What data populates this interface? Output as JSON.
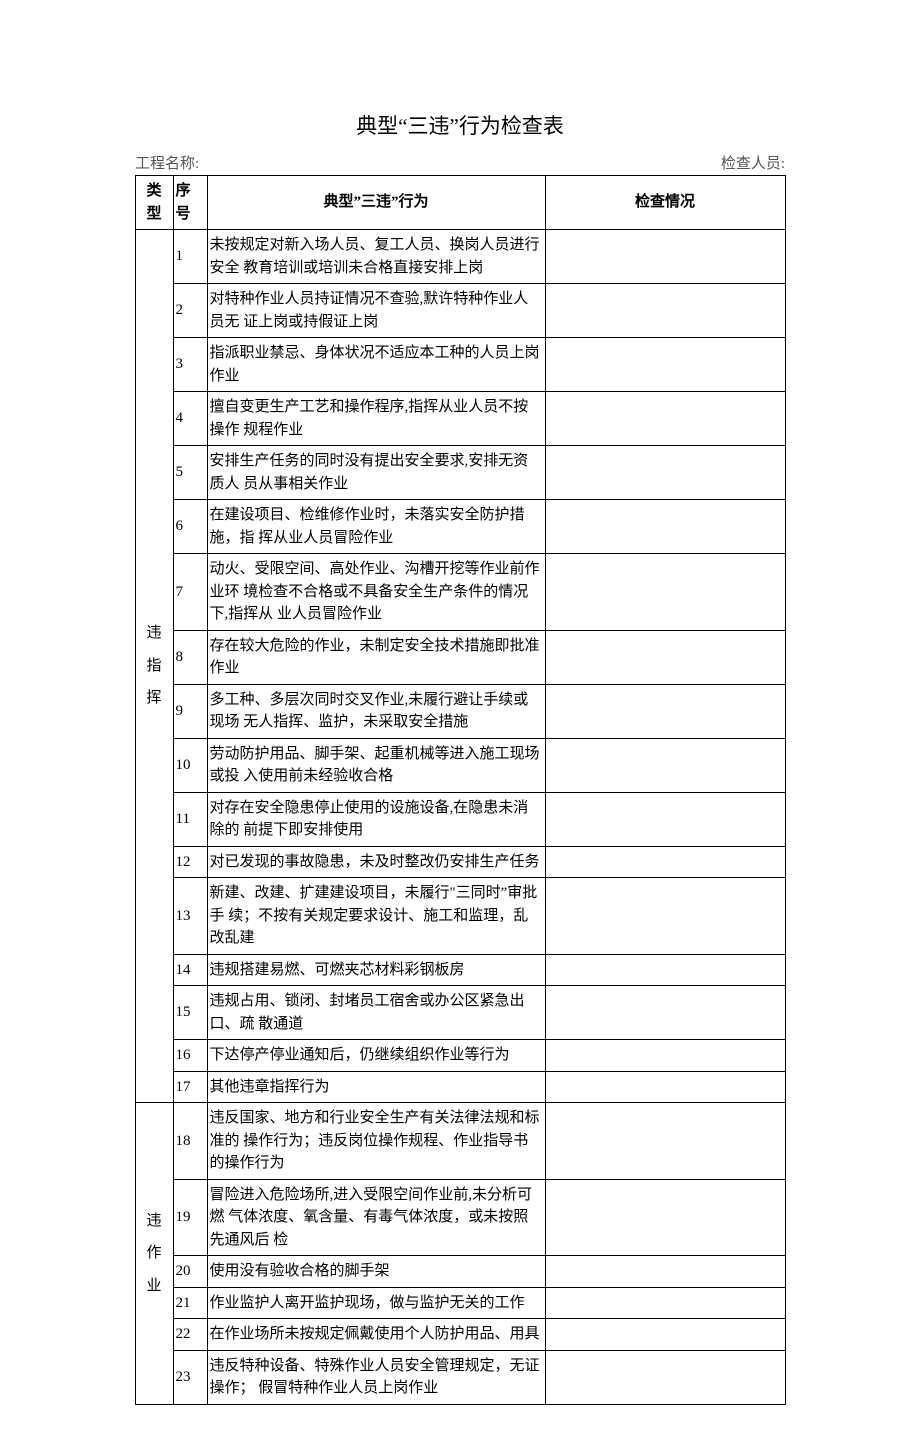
{
  "title": "典型“三违”行为检查表",
  "meta": {
    "project_label": "工程名称:",
    "inspector_label": "检查人员:"
  },
  "headers": {
    "category": "类 型",
    "index": "序 号",
    "behavior": "典型”三违”行为",
    "status": "检查情况"
  },
  "sections": [
    {
      "category_chars": [
        "违",
        "指",
        "挥"
      ],
      "rows": [
        {
          "n": "1",
          "text": "未按规定对新入场人员、复工人员、换岗人员进行安全  教育培训或培训未合格直接安排上岗"
        },
        {
          "n": "2",
          "text": "对特种作业人员持证情况不查验,默许特种作业人员无  证上岗或持假证上岗"
        },
        {
          "n": "3",
          "text": "指派职业禁忌、身体状况不适应本工种的人员上岗作业"
        },
        {
          "n": "4",
          "text": "擅自变更生产工艺和操作程序,指挥从业人员不按操作  规程作业"
        },
        {
          "n": "5",
          "text": "安排生产任务的同时没有提出安全要求,安排无资质人  员从事相关作业"
        },
        {
          "n": "6",
          "text": "在建设项目、检维修作业时，未落实安全防护措施，指  挥从业人员冒险作业"
        },
        {
          "n": "7",
          "text": "动火、受限空间、高处作业、沟槽开挖等作业前作业环  境检查不合格或不具备安全生产条件的情况下,指挥从  业人员冒险作业"
        },
        {
          "n": "8",
          "text": "存在较大危险的作业，未制定安全技术措施即批准作业"
        },
        {
          "n": "9",
          "text": "多工种、多层次同时交叉作业,未履行避让手续或现场  无人指挥、监护，未采取安全措施"
        },
        {
          "n": "10",
          "text": "劳动防护用品、脚手架、起重机械等进入施工现场或投  入使用前未经验收合格"
        },
        {
          "n": "11",
          "text": "对存在安全隐患停止使用的设施设备,在隐患未消除的  前提下即安排使用"
        },
        {
          "n": "12",
          "text": "对已发现的事故隐患，未及时整改仍安排生产任务"
        },
        {
          "n": "13",
          "text": "新建、改建、扩建建设项目，未履行\"三同时”审批手  续；不按有关规定要求设计、施工和监理，乱改乱建"
        },
        {
          "n": "14",
          "text": "违规搭建易燃、可燃夹芯材料彩钢板房"
        },
        {
          "n": "15",
          "text": "违规占用、锁闭、封堵员工宿舍或办公区紧急出口、疏  散通道"
        },
        {
          "n": "16",
          "text": "下达停产停业通知后，仍继续组织作业等行为"
        },
        {
          "n": "17",
          "text": "其他违章指挥行为"
        }
      ]
    },
    {
      "category_chars": [
        "违",
        "作",
        "业"
      ],
      "rows": [
        {
          "n": "18",
          "text": "违反国家、地方和行业安全生产有关法律法规和标准的  操作行为；违反岗位操作规程、作业指导书的操作行为"
        },
        {
          "n": "19",
          "text": "冒险进入危险场所,进入受限空间作业前,未分析可燃  气体浓度、氧含量、有毒气体浓度，或未按照先通风后  检"
        },
        {
          "n": "20",
          "text": "使用没有验收合格的脚手架"
        },
        {
          "n": "21",
          "text": "作业监护人离开监护现场，做与监护无关的工作"
        },
        {
          "n": "22",
          "text": "在作业场所未按规定佩戴使用个人防护用品、用具"
        },
        {
          "n": "23",
          "text": "违反特种设备、特殊作业人员安全管理规定，无证操作；  假冒特种作业人员上岗作业"
        }
      ]
    }
  ]
}
